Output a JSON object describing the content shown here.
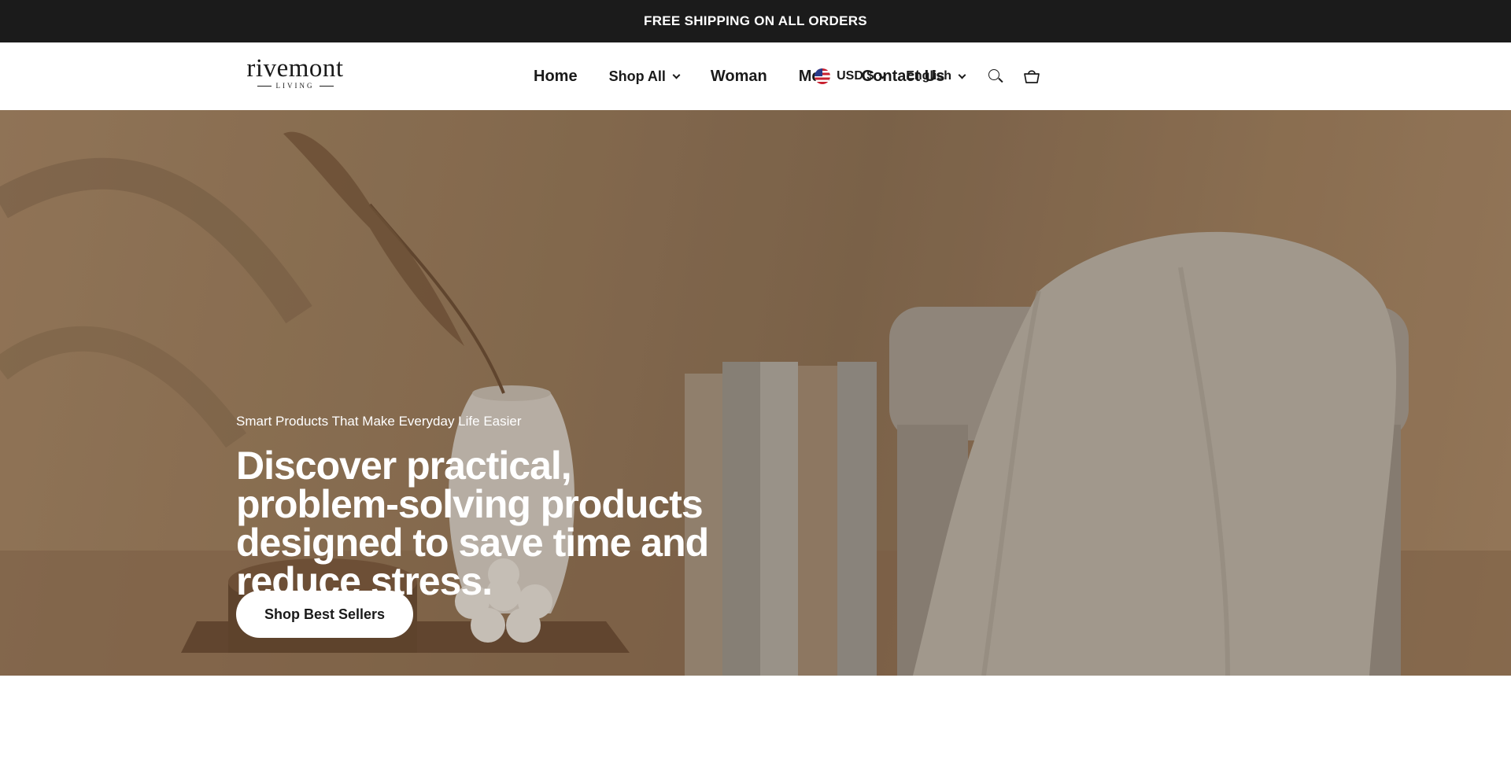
{
  "announcement": {
    "text": "FREE SHIPPING ON ALL ORDERS"
  },
  "header": {
    "logo": {
      "word": "rivemont",
      "subword": "LIVING"
    },
    "nav": [
      {
        "label": "Home"
      },
      {
        "label": "Shop All"
      },
      {
        "label": "Woman"
      },
      {
        "label": "Men"
      },
      {
        "label": "Contact Us"
      }
    ],
    "currency": {
      "label": "USD $"
    },
    "language": {
      "label": "English"
    }
  },
  "hero": {
    "eyebrow": "Smart Products That Make Everyday Life Easier",
    "headline": "Discover practical, problem-solving products designed to save time and reduce stress.",
    "cta_label": "Shop Best Sellers"
  },
  "icons": [
    "chevron-down-icon",
    "us-flag-icon",
    "search-icon",
    "cart-icon"
  ]
}
